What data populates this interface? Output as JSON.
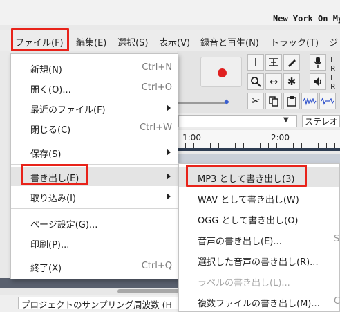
{
  "window": {
    "title": "New York On My"
  },
  "menubar": {
    "items": [
      {
        "label": "ファイル(F)"
      },
      {
        "label": "編集(E)"
      },
      {
        "label": "選択(S)"
      },
      {
        "label": "表示(V)"
      },
      {
        "label": "録音と再生(N)"
      },
      {
        "label": "トラック(T)"
      },
      {
        "label": "ジ"
      }
    ]
  },
  "file_menu": {
    "items": [
      {
        "label": "新規(N)",
        "accel": "Ctrl+N"
      },
      {
        "label": "開く(O)...",
        "accel": "Ctrl+O"
      },
      {
        "label": "最近のファイル(F)",
        "accel": ""
      },
      {
        "label": "閉じる(C)",
        "accel": "Ctrl+W"
      },
      {
        "label": "保存(S)",
        "accel": ""
      },
      {
        "label": "書き出し(E)",
        "accel": ""
      },
      {
        "label": "取り込み(I)",
        "accel": ""
      },
      {
        "label": "ページ設定(G)...",
        "accel": ""
      },
      {
        "label": "印刷(P)...",
        "accel": ""
      },
      {
        "label": "終了(X)",
        "accel": "Ctrl+Q"
      }
    ]
  },
  "export_submenu": {
    "items": [
      {
        "label": "MP3 として書き出し(3)",
        "accel": ""
      },
      {
        "label": "WAV として書き出し(W)",
        "accel": ""
      },
      {
        "label": "OGG として書き出し(O)",
        "accel": ""
      },
      {
        "label": "音声の書き出し(E)...",
        "accel": "S"
      },
      {
        "label": "選択した音声の書き出し(R)...",
        "accel": ""
      },
      {
        "label": "ラベルの書き出し(L)...",
        "accel": "",
        "disabled": true
      },
      {
        "label": "複数ファイルの書き出し(M)...",
        "accel": "C"
      }
    ]
  },
  "toolbar": {
    "channel_letters": [
      "L",
      "R",
      "L",
      "R"
    ]
  },
  "device_row": {
    "channels_value": "ステレオ"
  },
  "timeline": {
    "tick_labels": [
      "1:00",
      "2:00"
    ]
  },
  "statusbar": {
    "project_rate_label": "プロジェクトのサンプリング周波数 (H"
  },
  "colors": {
    "highlight_border": "#e8231a",
    "record_dot": "#e02020",
    "ruler_bar": "#2d3c52"
  }
}
